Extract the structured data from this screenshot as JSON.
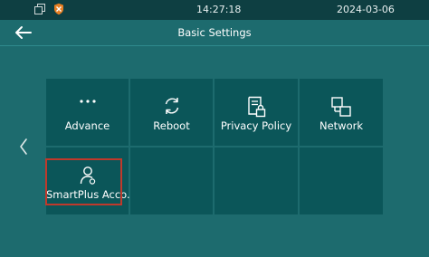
{
  "status": {
    "time": "14:27:18",
    "date": "2024-03-06",
    "icons": [
      "windows-icon",
      "shield-icon"
    ]
  },
  "header": {
    "title": "Basic Settings",
    "back_icon": "back-arrow-icon"
  },
  "nav": {
    "prev_icon": "chevron-left-icon"
  },
  "tiles": [
    {
      "label": "Advance",
      "icon": "more-dots-icon"
    },
    {
      "label": "Reboot",
      "icon": "refresh-icon"
    },
    {
      "label": "Privacy Policy",
      "icon": "privacy-lock-icon"
    },
    {
      "label": "Network",
      "icon": "network-icon"
    },
    {
      "label": "SmartPlus Acco...",
      "icon": "user-icon",
      "selected": true
    }
  ],
  "colors": {
    "background": "#1d6b6e",
    "tile": "#0b5659",
    "statusbar": "#0e3f42",
    "selection": "#c0392b"
  }
}
